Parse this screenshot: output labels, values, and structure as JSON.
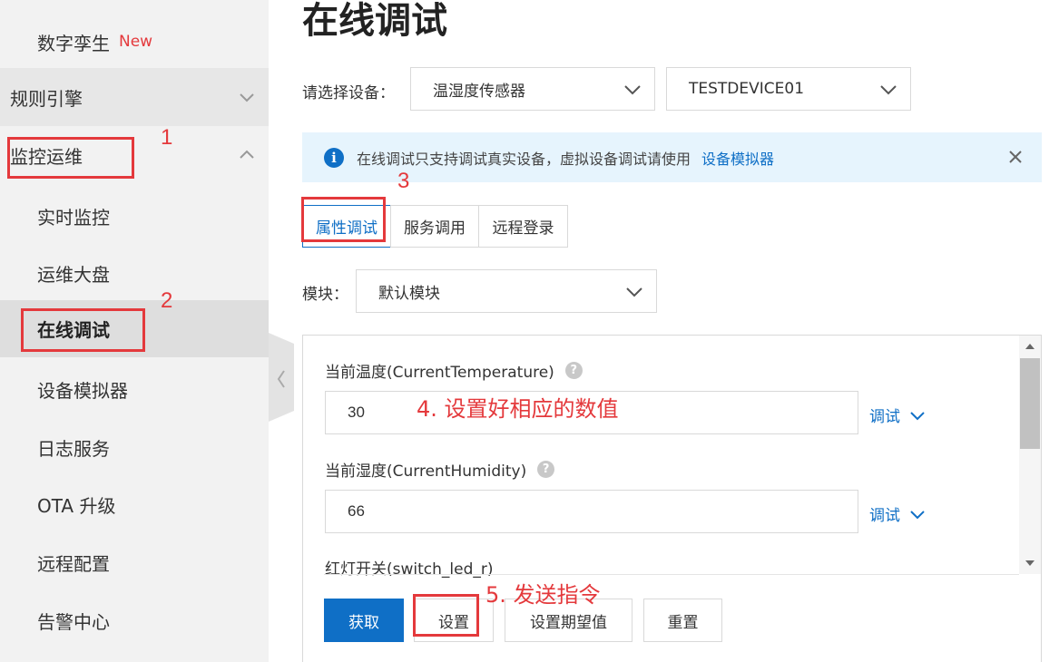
{
  "sidebar": {
    "digital_twin": {
      "label": "数字孪生",
      "badge": "New"
    },
    "rules_engine": "规则引擎",
    "monitor_ops": "监控运维",
    "items": [
      {
        "label": "实时监控"
      },
      {
        "label": "运维大盘"
      },
      {
        "label": "在线调试"
      },
      {
        "label": "设备模拟器"
      },
      {
        "label": "日志服务"
      },
      {
        "label": "OTA 升级"
      },
      {
        "label": "远程配置"
      },
      {
        "label": "告警中心"
      }
    ]
  },
  "page_title": "在线调试",
  "device_select": {
    "label": "请选择设备：",
    "product": "温湿度传感器",
    "device": "TESTDEVICE01"
  },
  "notice": {
    "text": "在线调试只支持调试真实设备，虚拟设备调试请使用",
    "link": "设备模拟器"
  },
  "tabs": [
    "属性调试",
    "服务调用",
    "远程登录"
  ],
  "module": {
    "label": "模块：",
    "value": "默认模块"
  },
  "properties": [
    {
      "label": "当前温度(CurrentTemperature)",
      "value": "30",
      "action": "调试"
    },
    {
      "label": "当前湿度(CurrentHumidity)",
      "value": "66",
      "action": "调试"
    },
    {
      "label": "红灯开关(switch_led_r)"
    }
  ],
  "buttons": {
    "get": "获取",
    "set": "设置",
    "set_expected": "设置期望值",
    "reset": "重置"
  },
  "annotations": {
    "n1": "1",
    "n2": "2",
    "n3": "3",
    "step4": "4. 设置好相应的数值",
    "step5": "5. 发送指令"
  },
  "colors": {
    "accent": "#0f6fc6",
    "annotation": "#e4393c",
    "sidebar_bg": "#f2f2f2"
  }
}
